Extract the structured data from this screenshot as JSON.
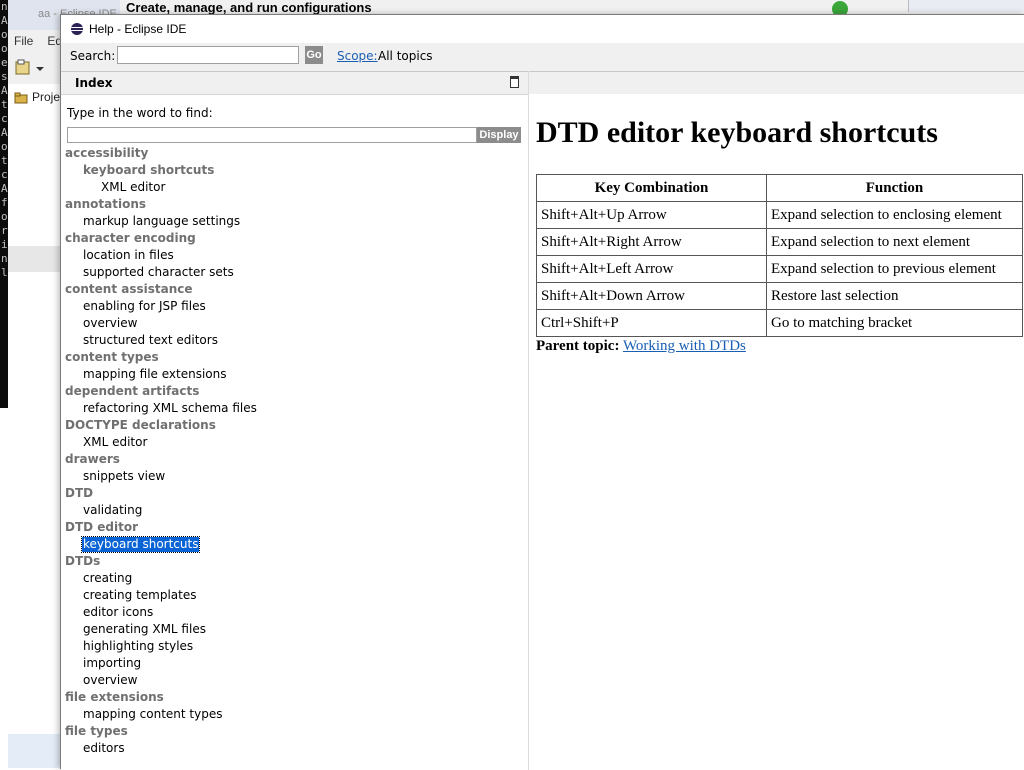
{
  "background": {
    "terminal_chars": [
      "n",
      "A",
      "o",
      "o",
      "e",
      "",
      "",
      "",
      "s",
      "A",
      "t",
      "c",
      "A",
      "o",
      "t",
      "c",
      "A",
      "f",
      "o",
      "r",
      "i",
      "n",
      "l"
    ],
    "window_title": "aa - Eclipse IDE",
    "menu": [
      "File",
      "Ed"
    ],
    "project_label": "Proje",
    "launch_dialog_title": "Create, manage, and run configurations"
  },
  "help_window": {
    "title": "Help - Eclipse IDE",
    "search": {
      "label": "Search:",
      "value": "",
      "go_label": "Go",
      "scope_link": "Scope:",
      "scope_value": "All topics"
    },
    "index": {
      "title": "Index",
      "type_label": "Type in the word to find:",
      "input_value": "",
      "display_label": "Display",
      "entries": [
        {
          "text": "accessibility",
          "level": 0
        },
        {
          "text": "keyboard shortcuts",
          "level": 1,
          "bold": true
        },
        {
          "text": "XML editor",
          "level": 2
        },
        {
          "text": "annotations",
          "level": 0
        },
        {
          "text": "markup language settings",
          "level": 1
        },
        {
          "text": "character encoding",
          "level": 0
        },
        {
          "text": "location in files",
          "level": 1
        },
        {
          "text": "supported character sets",
          "level": 1
        },
        {
          "text": "content assistance",
          "level": 0
        },
        {
          "text": "enabling for JSP files",
          "level": 1
        },
        {
          "text": "overview",
          "level": 1
        },
        {
          "text": "structured text editors",
          "level": 1
        },
        {
          "text": "content types",
          "level": 0
        },
        {
          "text": "mapping file extensions",
          "level": 1
        },
        {
          "text": "dependent artifacts",
          "level": 0
        },
        {
          "text": "refactoring XML schema files",
          "level": 1
        },
        {
          "text": "DOCTYPE declarations",
          "level": 0
        },
        {
          "text": "XML editor",
          "level": 1
        },
        {
          "text": "drawers",
          "level": 0
        },
        {
          "text": "snippets view",
          "level": 1
        },
        {
          "text": "DTD",
          "level": 0
        },
        {
          "text": "validating",
          "level": 1
        },
        {
          "text": "DTD editor",
          "level": 0
        },
        {
          "text": "keyboard shortcuts",
          "level": 1,
          "selected": true
        },
        {
          "text": "DTDs",
          "level": 0
        },
        {
          "text": "creating",
          "level": 1
        },
        {
          "text": "creating templates",
          "level": 1
        },
        {
          "text": "editor icons",
          "level": 1
        },
        {
          "text": "generating XML files",
          "level": 1
        },
        {
          "text": "highlighting styles",
          "level": 1
        },
        {
          "text": "importing",
          "level": 1
        },
        {
          "text": "overview",
          "level": 1
        },
        {
          "text": "file extensions",
          "level": 0
        },
        {
          "text": "mapping content types",
          "level": 1
        },
        {
          "text": "file types",
          "level": 0
        },
        {
          "text": "editors",
          "level": 1
        }
      ]
    },
    "content": {
      "heading": "DTD editor keyboard shortcuts",
      "table": {
        "headers": [
          "Key Combination",
          "Function"
        ],
        "rows": [
          [
            "Shift+Alt+Up Arrow",
            "Expand selection to enclosing element"
          ],
          [
            "Shift+Alt+Right Arrow",
            "Expand selection to next element"
          ],
          [
            "Shift+Alt+Left Arrow",
            "Expand selection to previous element"
          ],
          [
            "Shift+Alt+Down Arrow",
            "Restore last selection"
          ],
          [
            "Ctrl+Shift+P",
            "Go to matching bracket"
          ]
        ]
      },
      "parent_topic_label": "Parent topic:",
      "parent_topic_link": "Working with DTDs"
    }
  }
}
